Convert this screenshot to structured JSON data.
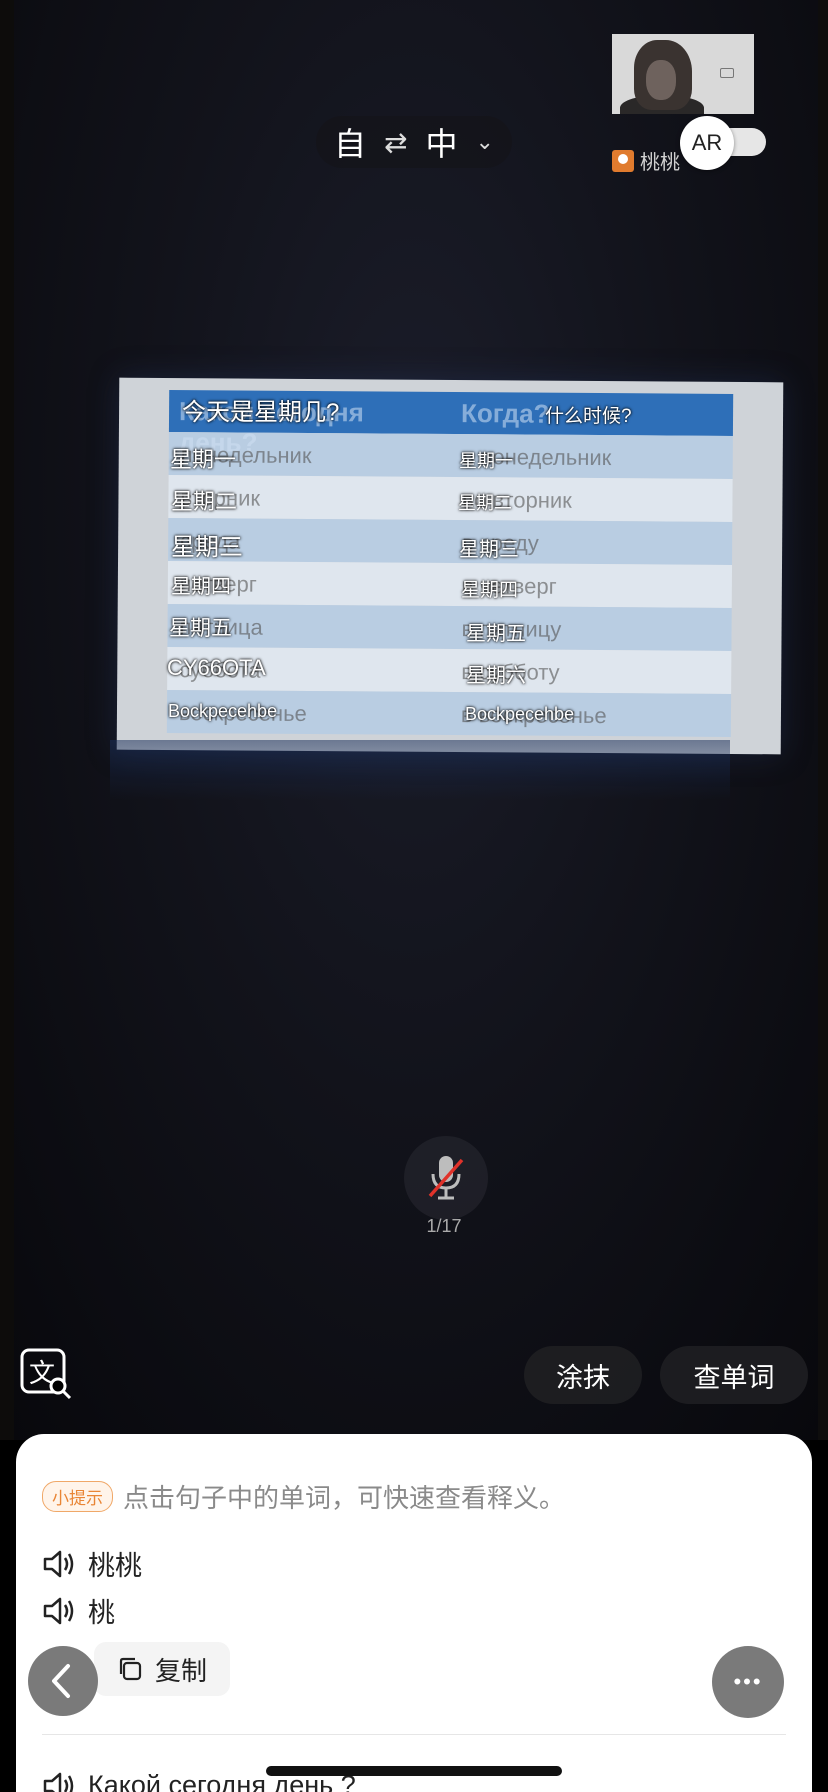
{
  "language_bar": {
    "source": "自",
    "swap_symbol": "⇄",
    "target": "中",
    "chevron": "⌄"
  },
  "ar_toggle": {
    "label": "AR",
    "enabled": false
  },
  "participant": {
    "name": "桃桃"
  },
  "slide": {
    "header": [
      "Какой сегодня день?",
      "Когда?"
    ],
    "rows": [
      [
        "понедельник",
        "в понедельник"
      ],
      [
        "вторник",
        "во вторник"
      ],
      [
        "среда",
        "в среду"
      ],
      [
        "четверг",
        "в четверг"
      ],
      [
        "пятница",
        "в пятницу"
      ],
      [
        "суббота",
        "в субботу"
      ],
      [
        "воскресенье",
        "в воскресенье"
      ]
    ]
  },
  "overlays": {
    "header_left": "今天是星期几?",
    "header_right": "什么时候?",
    "left": [
      "星期一",
      "星期二",
      "星期三",
      "星期四",
      "星期五",
      "CY66OTA",
      "Bockpecehbe"
    ],
    "right": [
      "星期一",
      "星期二",
      "星期三",
      "星期四",
      "星期五",
      "星期六",
      "Bockpecehbe"
    ]
  },
  "mic": {
    "muted": true,
    "page_count": "1/17"
  },
  "tools": {
    "smear_label": "涂抹",
    "lookup_label": "查单词",
    "translate_icon": "translate-search-icon"
  },
  "sheet": {
    "hint_badge": "小提示",
    "hint_text": "点击句子中的单词，可快速查看释义。",
    "lines": [
      "桃桃",
      "桃"
    ],
    "copy_label": "复制",
    "sentence": "Какой сегодня день ?"
  },
  "more_label": "•••",
  "colors": {
    "accent": "#e98535",
    "slide_header": "#2e6fb8",
    "mic_slash": "#e0322a"
  }
}
